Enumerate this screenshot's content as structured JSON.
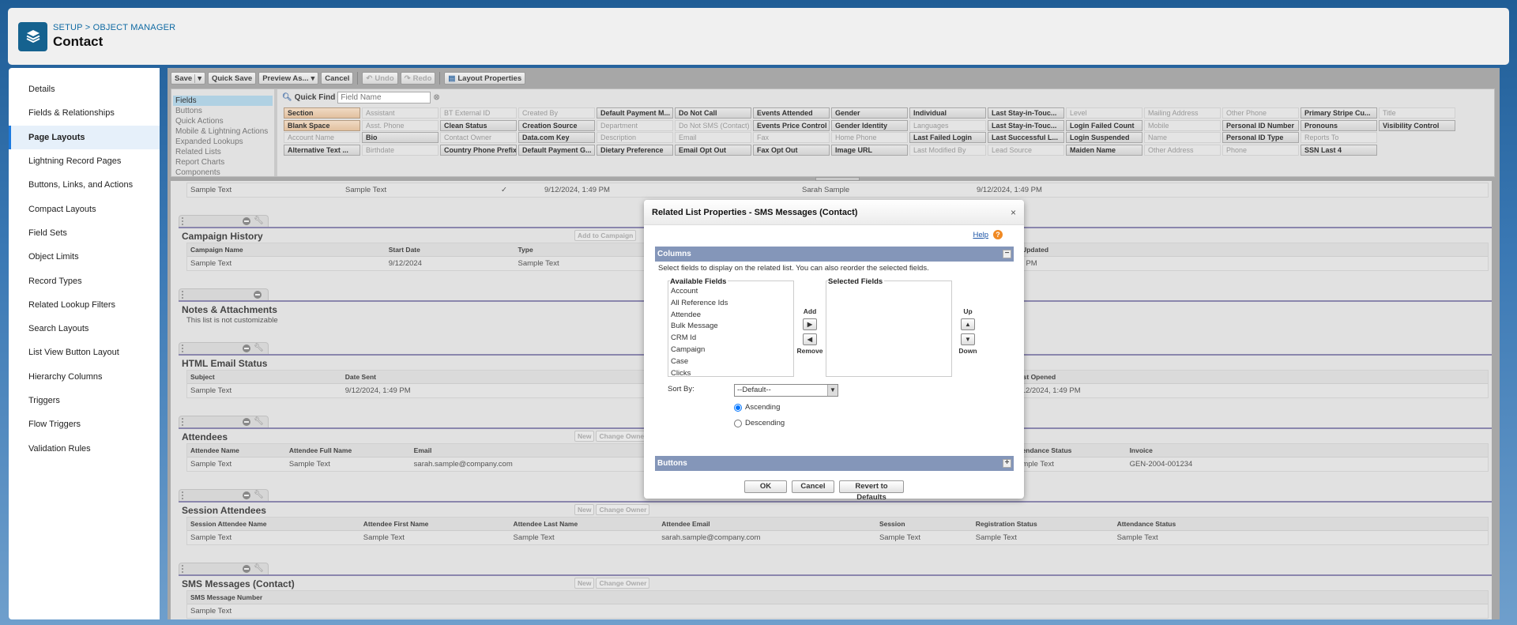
{
  "header": {
    "breadcrumb": "SETUP > OBJECT MANAGER",
    "title": "Contact",
    "icon": "layers-icon",
    "brand_color": "#15628f"
  },
  "sidebar": {
    "items": [
      {
        "label": "Details"
      },
      {
        "label": "Fields & Relationships"
      },
      {
        "label": "Page Layouts",
        "active": true
      },
      {
        "label": "Lightning Record Pages"
      },
      {
        "label": "Buttons, Links, and Actions"
      },
      {
        "label": "Compact Layouts"
      },
      {
        "label": "Field Sets"
      },
      {
        "label": "Object Limits"
      },
      {
        "label": "Record Types"
      },
      {
        "label": "Related Lookup Filters"
      },
      {
        "label": "Search Layouts"
      },
      {
        "label": "List View Button Layout"
      },
      {
        "label": "Hierarchy Columns"
      },
      {
        "label": "Triggers"
      },
      {
        "label": "Flow Triggers"
      },
      {
        "label": "Validation Rules"
      }
    ]
  },
  "toolbar": {
    "save": "Save",
    "quick_save": "Quick Save",
    "preview": "Preview As...",
    "cancel": "Cancel",
    "undo": "Undo",
    "redo": "Redo",
    "layout_properties": "Layout Properties"
  },
  "palette": {
    "categories": [
      {
        "label": "Fields",
        "active": true
      },
      {
        "label": "Buttons"
      },
      {
        "label": "Quick Actions"
      },
      {
        "label": "Mobile & Lightning Actions"
      },
      {
        "label": "Expanded Lookups"
      },
      {
        "label": "Related Lists"
      },
      {
        "label": "Report Charts"
      },
      {
        "label": "Components"
      }
    ],
    "quick_find_label": "Quick Find",
    "quick_find_placeholder": "Field Name",
    "quick_find_value": "",
    "fields": [
      {
        "label": "Section",
        "state": "special"
      },
      {
        "label": "Blank Space",
        "state": "special"
      },
      {
        "label": "Account Name",
        "state": "used"
      },
      {
        "label": "Alternative Text ...",
        "state": "avail"
      },
      {
        "label": "Assistant",
        "state": "used"
      },
      {
        "label": "Asst. Phone",
        "state": "used"
      },
      {
        "label": "Bio",
        "state": "avail"
      },
      {
        "label": "Birthdate",
        "state": "used"
      },
      {
        "label": "BT External ID",
        "state": "used"
      },
      {
        "label": "Clean Status",
        "state": "avail"
      },
      {
        "label": "Contact Owner",
        "state": "used"
      },
      {
        "label": "Country Phone Prefix",
        "state": "avail"
      },
      {
        "label": "Created By",
        "state": "used"
      },
      {
        "label": "Creation Source",
        "state": "avail"
      },
      {
        "label": "Data.com Key",
        "state": "avail"
      },
      {
        "label": "Default Payment G...",
        "state": "avail"
      },
      {
        "label": "Default Payment M...",
        "state": "avail"
      },
      {
        "label": "Department",
        "state": "used"
      },
      {
        "label": "Description",
        "state": "used"
      },
      {
        "label": "Dietary Preference",
        "state": "avail"
      },
      {
        "label": "Do Not Call",
        "state": "avail"
      },
      {
        "label": "Do Not SMS (Contact)",
        "state": "used"
      },
      {
        "label": "Email",
        "state": "used"
      },
      {
        "label": "Email Opt Out",
        "state": "avail"
      },
      {
        "label": "Events Attended",
        "state": "avail"
      },
      {
        "label": "Events Price Control",
        "state": "avail"
      },
      {
        "label": "Fax",
        "state": "used"
      },
      {
        "label": "Fax Opt Out",
        "state": "avail"
      },
      {
        "label": "Gender",
        "state": "avail"
      },
      {
        "label": "Gender Identity",
        "state": "avail"
      },
      {
        "label": "Home Phone",
        "state": "used"
      },
      {
        "label": "Image URL",
        "state": "avail"
      },
      {
        "label": "Individual",
        "state": "avail"
      },
      {
        "label": "Languages",
        "state": "used"
      },
      {
        "label": "Last Failed Login",
        "state": "avail"
      },
      {
        "label": "Last Modified By",
        "state": "used"
      },
      {
        "label": "Last Stay-in-Touc...",
        "state": "avail"
      },
      {
        "label": "Last Stay-in-Touc...",
        "state": "avail"
      },
      {
        "label": "Last Successful L...",
        "state": "avail"
      },
      {
        "label": "Lead Source",
        "state": "used"
      },
      {
        "label": "Level",
        "state": "used"
      },
      {
        "label": "Login Failed Count",
        "state": "avail"
      },
      {
        "label": "Login Suspended",
        "state": "avail"
      },
      {
        "label": "Maiden Name",
        "state": "avail"
      },
      {
        "label": "Mailing Address",
        "state": "used"
      },
      {
        "label": "Mobile",
        "state": "used"
      },
      {
        "label": "Name",
        "state": "used"
      },
      {
        "label": "Other Address",
        "state": "used"
      },
      {
        "label": "Other Phone",
        "state": "used"
      },
      {
        "label": "Personal ID Number",
        "state": "avail"
      },
      {
        "label": "Personal ID Type",
        "state": "avail"
      },
      {
        "label": "Phone",
        "state": "used"
      },
      {
        "label": "Primary Stripe Cu...",
        "state": "avail"
      },
      {
        "label": "Pronouns",
        "state": "avail"
      },
      {
        "label": "Reports To",
        "state": "used"
      },
      {
        "label": "SSN Last 4",
        "state": "avail"
      },
      {
        "label": "Title",
        "state": "used"
      },
      {
        "label": "Visibility Control",
        "state": "avail"
      }
    ]
  },
  "sections": [
    {
      "id": "top",
      "title": "",
      "partial": true,
      "buttons": [],
      "columns": [],
      "rows": [
        [
          "Sample Text",
          "Sample Text",
          "✓",
          "9/12/2024, 1:49 PM",
          "Sarah Sample",
          "9/12/2024, 1:49 PM"
        ]
      ]
    },
    {
      "id": "campaign",
      "title": "Campaign History",
      "wrench": true,
      "buttons": [
        "Add to Campaign"
      ],
      "columns": [
        "Campaign Name",
        "Start Date",
        "Type",
        "Member Status Updated"
      ],
      "rows": [
        [
          "Sample Text",
          "9/12/2024",
          "Sample Text",
          "9/12/2024, 1:49 PM"
        ]
      ]
    },
    {
      "id": "notes",
      "title": "Notes & Attachments",
      "wrench": false,
      "buttons": [],
      "note": "This list is not customizable",
      "columns": [],
      "rows": []
    },
    {
      "id": "html-email",
      "title": "HTML Email Status",
      "wrench": true,
      "buttons": [],
      "columns": [
        "Subject",
        "Date Sent",
        "Last Opened"
      ],
      "rows": [
        [
          "Sample Text",
          "9/12/2024, 1:49 PM",
          "9/12/2024, 1:49 PM"
        ]
      ]
    },
    {
      "id": "attendees",
      "title": "Attendees",
      "wrench": true,
      "buttons": [
        "New",
        "Change Owner"
      ],
      "columns": [
        "Attendee Name",
        "Attendee Full Name",
        "Email",
        "Registration Status",
        "Attendance Status",
        "Invoice"
      ],
      "rows": [
        [
          "Sample Text",
          "Sample Text",
          "sarah.sample@company.com",
          "Sample Text",
          "Sample Text",
          "GEN-2004-001234"
        ]
      ]
    },
    {
      "id": "session",
      "title": "Session Attendees",
      "wrench": true,
      "buttons": [
        "New",
        "Change Owner"
      ],
      "columns": [
        "Session Attendee Name",
        "Attendee First Name",
        "Attendee Last Name",
        "Attendee Email",
        "Session",
        "Registration Status",
        "Attendance Status"
      ],
      "rows": [
        [
          "Sample Text",
          "Sample Text",
          "Sample Text",
          "sarah.sample@company.com",
          "Sample Text",
          "Sample Text",
          "Sample Text"
        ]
      ]
    },
    {
      "id": "sms",
      "title": "SMS Messages (Contact)",
      "wrench": true,
      "buttons": [
        "New",
        "Change Owner"
      ],
      "columns": [
        "SMS Message Number"
      ],
      "rows": [
        [
          "Sample Text"
        ]
      ]
    }
  ],
  "dialog": {
    "title": "Related List Properties - SMS Messages (Contact)",
    "help": "Help",
    "columns_header": "Columns",
    "instructions": "Select fields to display on the related list. You can also reorder the selected fields.",
    "available_label": "Available Fields",
    "available": [
      "Account",
      "All Reference Ids",
      "Attendee",
      "Bulk Message",
      "CRM Id",
      "Campaign",
      "Case",
      "Clicks"
    ],
    "selected_label": "Selected Fields",
    "selected": [],
    "add": "Add",
    "remove": "Remove",
    "up": "Up",
    "down": "Down",
    "sort_by_label": "Sort By:",
    "sort_by_value": "--Default--",
    "ascending": "Ascending",
    "descending": "Descending",
    "sort_order": "Ascending",
    "buttons_header": "Buttons",
    "ok": "OK",
    "cancel": "Cancel",
    "revert": "Revert to Defaults",
    "bar_color": "#8496b9"
  }
}
